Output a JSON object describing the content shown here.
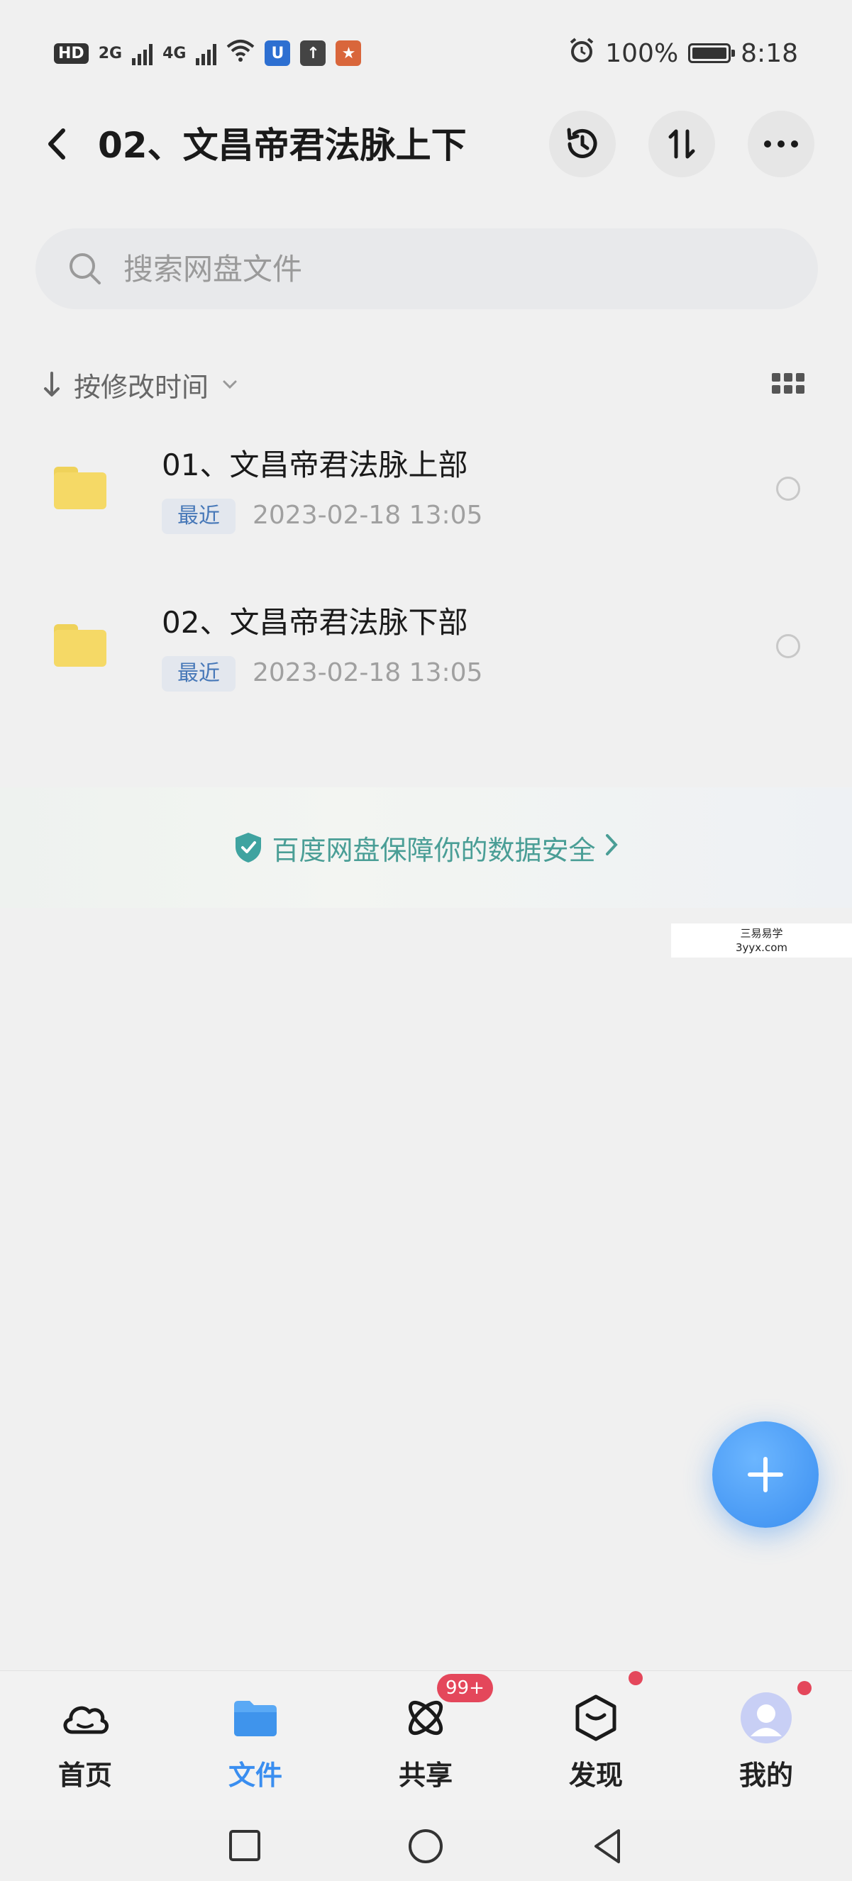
{
  "status_bar": {
    "hd_label": "HD",
    "sim1": "2G",
    "sim2": "4G",
    "battery_text": "100%",
    "battery_level": 1.0,
    "time": "8:18"
  },
  "header": {
    "title": "02、文昌帝君法脉上下"
  },
  "search": {
    "placeholder": "搜索网盘文件"
  },
  "sort": {
    "label": "按修改时间"
  },
  "files": [
    {
      "name": "01、文昌帝君法脉上部",
      "badge": "最近",
      "date": "2023-02-18  13:05"
    },
    {
      "name": "02、文昌帝君法脉下部",
      "badge": "最近",
      "date": "2023-02-18  13:05"
    }
  ],
  "banner": {
    "text": "百度网盘保障你的数据安全"
  },
  "watermark": {
    "line1": "三易易学",
    "line2": "3yyx.com"
  },
  "bottom_nav": [
    {
      "label": "首页",
      "icon": "cloud-icon"
    },
    {
      "label": "文件",
      "icon": "folder-icon",
      "active": true
    },
    {
      "label": "共享",
      "icon": "share-orbit-icon",
      "badge": "99+"
    },
    {
      "label": "发现",
      "icon": "discover-box-icon"
    },
    {
      "label": "我的",
      "icon": "avatar-icon"
    }
  ],
  "colors": {
    "accent": "#3a8ef0",
    "badge_red": "#e4475b",
    "banner_teal": "#4a9e96",
    "folder_yellow": "#f5d966"
  }
}
